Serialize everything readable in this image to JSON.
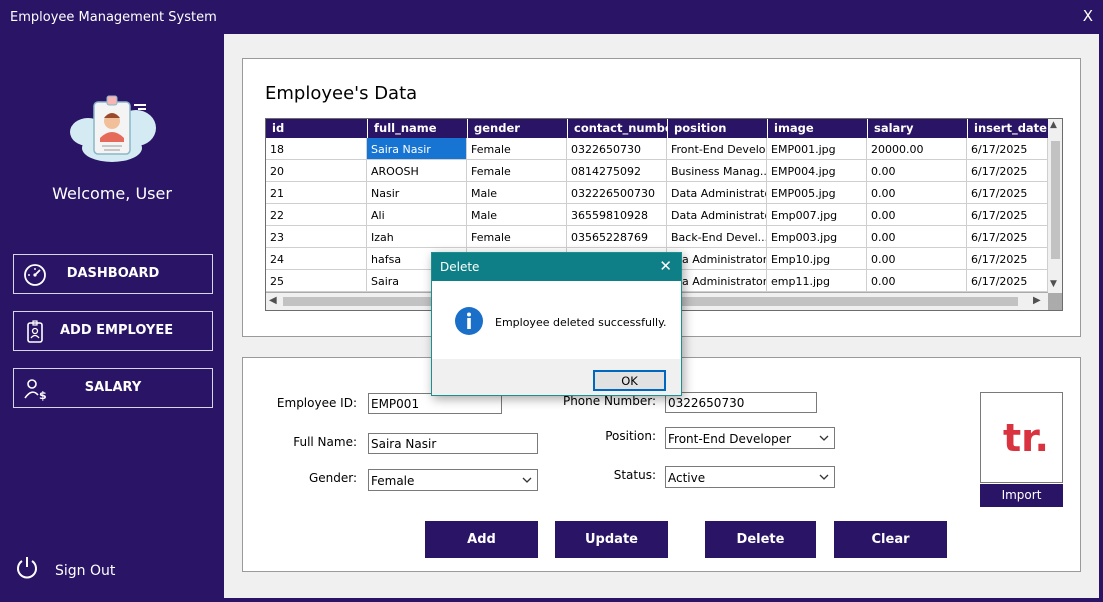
{
  "window": {
    "title": "Employee Management System",
    "close_glyph": "X"
  },
  "sidebar": {
    "welcome": "Welcome, User",
    "nav": [
      {
        "label": "DASHBOARD",
        "icon": "gauge-icon"
      },
      {
        "label": "ADD EMPLOYEE",
        "icon": "id-badge-icon"
      },
      {
        "label": "SALARY",
        "icon": "user-salary-icon"
      }
    ],
    "signout": {
      "label": "Sign Out",
      "icon": "power-icon"
    }
  },
  "data_panel": {
    "title": "Employee's Data",
    "columns": [
      "id",
      "full_name",
      "gender",
      "contact_number",
      "position",
      "image",
      "salary",
      "insert_date"
    ],
    "rows": [
      [
        "18",
        "Saira Nasir",
        "Female",
        "0322650730",
        "Front-End Develo...",
        "EMP001.jpg",
        "20000.00",
        "6/17/2025"
      ],
      [
        "20",
        "AROOSH",
        "Female",
        "0814275092",
        "Business Manag...",
        "EMP004.jpg",
        "0.00",
        "6/17/2025"
      ],
      [
        "21",
        "Nasir",
        "Male",
        "032226500730",
        "Data Administrator",
        "EMP005.jpg",
        "0.00",
        "6/17/2025"
      ],
      [
        "22",
        "Ali",
        "Male",
        "36559810928",
        "Data Administrator",
        "Emp007.jpg",
        "0.00",
        "6/17/2025"
      ],
      [
        "23",
        "Izah",
        "Female",
        "03565228769",
        "Back-End Devel...",
        "Emp003.jpg",
        "0.00",
        "6/17/2025"
      ],
      [
        "24",
        "hafsa",
        "",
        "",
        "ata Administrator",
        "Emp10.jpg",
        "0.00",
        "6/17/2025"
      ],
      [
        "25",
        "Saira",
        "",
        "",
        "ata Administrator",
        "emp11.jpg",
        "0.00",
        "6/17/2025"
      ]
    ]
  },
  "form": {
    "employee_id_label": "Employee ID:",
    "employee_id_value": "EMP001",
    "full_name_label": "Full Name:",
    "full_name_value": "Saira Nasir",
    "gender_label": "Gender:",
    "gender_value": "Female",
    "phone_label": "Phone Number:",
    "phone_value": "0322650730",
    "position_label": "Position:",
    "position_value": "Front-End Developer",
    "status_label": "Status:",
    "status_value": "Active",
    "import_label": "Import",
    "photo_logo": "tr."
  },
  "actions": {
    "add": "Add",
    "update": "Update",
    "delete": "Delete",
    "clear": "Clear"
  },
  "dialog": {
    "title": "Delete",
    "message": "Employee deleted successfully.",
    "ok": "OK",
    "close_glyph": "✕",
    "icon": "info-icon"
  },
  "colors": {
    "brand": "#2a1466",
    "selection": "#1874d3",
    "dialog_header": "#0e7f86",
    "logo_red": "#d9333f"
  }
}
